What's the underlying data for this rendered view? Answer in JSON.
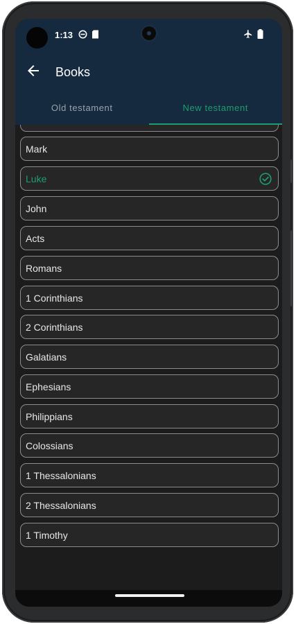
{
  "status_bar": {
    "time": "1:13",
    "left_icons": [
      "do-not-disturb-icon",
      "sd-card-icon"
    ],
    "right_icons": [
      "airplane-mode-icon",
      "battery-icon"
    ]
  },
  "app_bar": {
    "title": "Books",
    "back_icon": "arrow-back-icon"
  },
  "tabs": [
    {
      "label": "Old testament",
      "active": false
    },
    {
      "label": "New testament",
      "active": true
    }
  ],
  "books": [
    {
      "label": "",
      "selected": false
    },
    {
      "label": "Mark",
      "selected": false
    },
    {
      "label": "Luke",
      "selected": true
    },
    {
      "label": "John",
      "selected": false
    },
    {
      "label": "Acts",
      "selected": false
    },
    {
      "label": "Romans",
      "selected": false
    },
    {
      "label": "1 Corinthians",
      "selected": false
    },
    {
      "label": "2 Corinthians",
      "selected": false
    },
    {
      "label": "Galatians",
      "selected": false
    },
    {
      "label": "Ephesians",
      "selected": false
    },
    {
      "label": "Philippians",
      "selected": false
    },
    {
      "label": "Colossians",
      "selected": false
    },
    {
      "label": "1 Thessalonians",
      "selected": false
    },
    {
      "label": "2 Thessalonians",
      "selected": false
    },
    {
      "label": "1 Timothy",
      "selected": false
    }
  ],
  "colors": {
    "app_bar": "#152a3f",
    "accent": "#1e9e6e",
    "background": "#1c1c1c",
    "item_border": "#8c8c8c"
  }
}
